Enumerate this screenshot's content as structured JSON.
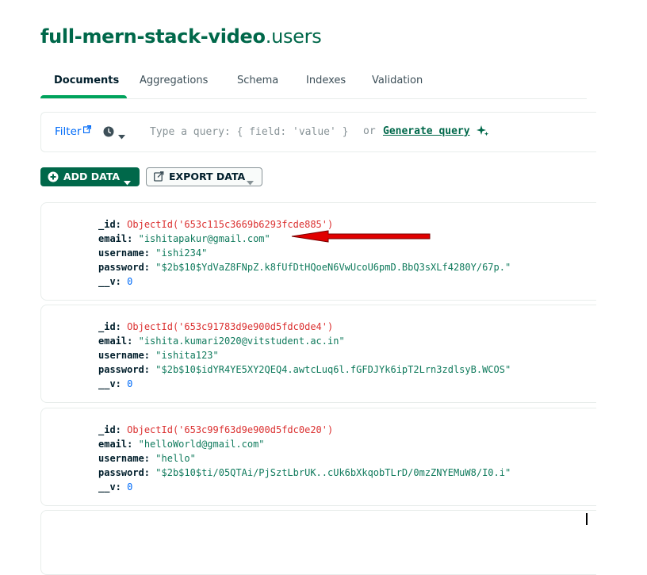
{
  "header": {
    "db_name": "full-mern-stack-video",
    "collection_name": ".users"
  },
  "tabs": [
    {
      "label": "Documents",
      "active": true
    },
    {
      "label": "Aggregations",
      "active": false
    },
    {
      "label": "Schema",
      "active": false
    },
    {
      "label": "Indexes",
      "active": false
    },
    {
      "label": "Validation",
      "active": false
    }
  ],
  "query": {
    "filter_label": "Filter",
    "placeholder": "Type a query: { field: 'value' }",
    "or_text": "or",
    "generate_label": "Generate query"
  },
  "toolbar": {
    "add_data_label": "ADD DATA",
    "export_data_label": "EXPORT DATA"
  },
  "documents": [
    {
      "id_key": "_id:",
      "id_value": "ObjectId('653c115c3669b6293fcde885')",
      "email_key": "email:",
      "email_value": "\"ishitapakur@gmail.com\"",
      "username_key": "username:",
      "username_value": "\"ishi234\"",
      "password_key": "password:",
      "password_value": "\"$2b$10$YdVaZ8FNpZ.k8fUfDtHQoeN6VwUcoU6pmD.BbQ3sXLf4280Y/67p.\"",
      "v_key": "__v:",
      "v_value": "0"
    },
    {
      "id_key": "_id:",
      "id_value": "ObjectId('653c91783d9e900d5fdc0de4')",
      "email_key": "email:",
      "email_value": "\"ishita.kumari2020@vitstudent.ac.in\"",
      "username_key": "username:",
      "username_value": "\"ishita123\"",
      "password_key": "password:",
      "password_value": "\"$2b$10$idYR4YE5XY2QEQ4.awtcLuq6l.fGFDJYk6ipT2Lrn3zdlsyB.WCOS\"",
      "v_key": "__v:",
      "v_value": "0"
    },
    {
      "id_key": "_id:",
      "id_value": "ObjectId('653c99f63d9e900d5fdc0e20')",
      "email_key": "email:",
      "email_value": "\"helloWorld@gmail.com\"",
      "username_key": "username:",
      "username_value": "\"hello\"",
      "password_key": "password:",
      "password_value": "\"$2b$10$ti/05QTAi/PjSztLbrUK..cUk6bXkqobTLrD/0mzZNYEMuW8/I0.i\"",
      "v_key": "__v:",
      "v_value": "0"
    }
  ],
  "colors": {
    "brand_green": "#00684a",
    "tab_underline": "#00a35c",
    "objectid_red": "#db3030",
    "string_green": "#0f7a5c",
    "number_blue": "#016bf8",
    "annotation_arrow": "#e00000"
  },
  "icons": {
    "filter": "external-link-icon",
    "history": "clock-icon",
    "generate": "sparkle-icon",
    "add": "plus-circle-icon",
    "export": "export-icon"
  }
}
